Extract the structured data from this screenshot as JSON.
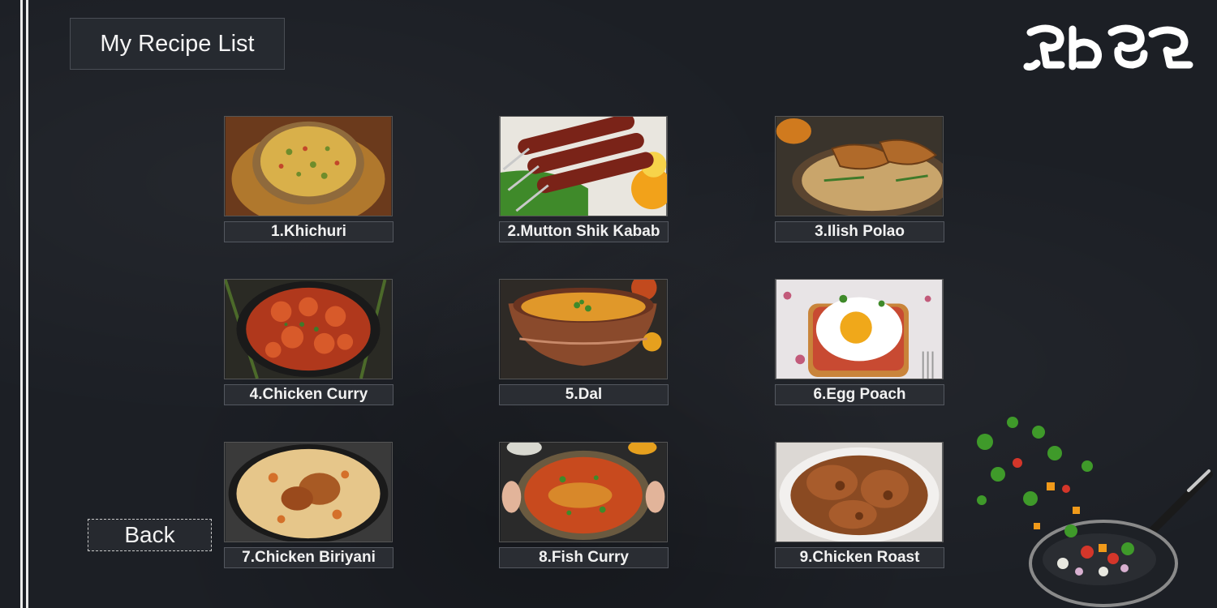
{
  "header": {
    "title": "My Recipe List"
  },
  "recipes": [
    {
      "label": "1.Khichuri"
    },
    {
      "label": "2.Mutton Shik Kabab"
    },
    {
      "label": "3.Ilish Polao"
    },
    {
      "label": "4.Chicken Curry"
    },
    {
      "label": "5.Dal"
    },
    {
      "label": "6.Egg Poach"
    },
    {
      "label": "7.Chicken Biriyani"
    },
    {
      "label": "8.Fish Curry"
    },
    {
      "label": "9.Chicken Roast"
    }
  ],
  "back_button": {
    "label": "Back"
  },
  "colors": {
    "background": "#1c1f25",
    "panel": "#2a2d33",
    "text": "#f1f1f1"
  }
}
